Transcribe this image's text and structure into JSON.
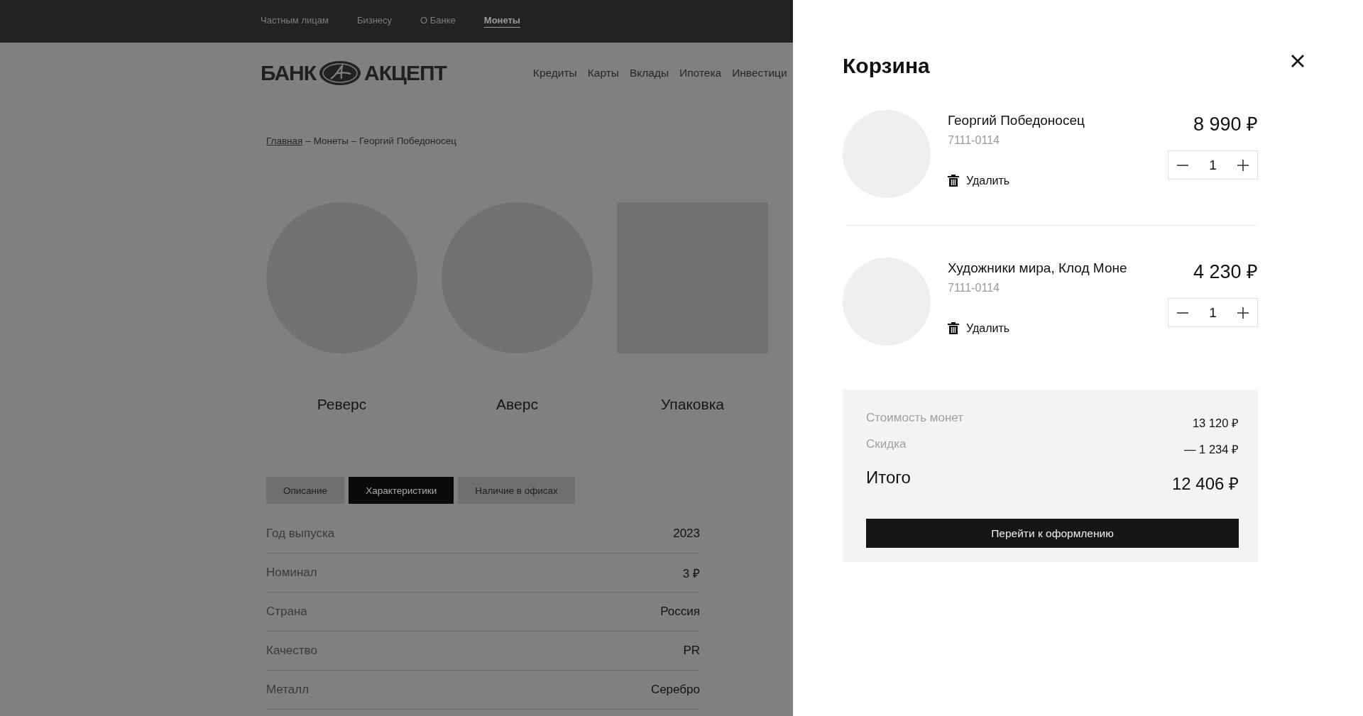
{
  "top_nav": [
    {
      "label": "Частным лицам",
      "selected": false
    },
    {
      "label": "Бизнесу",
      "selected": false
    },
    {
      "label": "О Банке",
      "selected": false
    },
    {
      "label": "Монеты",
      "selected": true
    }
  ],
  "logo": {
    "left": "БАНК",
    "right": "АКЦЕПТ"
  },
  "main_nav": [
    "Кредиты",
    "Карты",
    "Вклады",
    "Ипотека",
    "Инвестици"
  ],
  "breadcrumb": {
    "link": "Главная",
    "rest": "– Монеты – Георгий Победоносец"
  },
  "gallery": [
    {
      "label": "Реверс",
      "kind": "circle"
    },
    {
      "label": "Аверс",
      "kind": "circle"
    },
    {
      "label": "Упаковка",
      "kind": "square"
    }
  ],
  "tabs": [
    {
      "label": "Описание",
      "selected": false
    },
    {
      "label": "Характеристики",
      "selected": true
    },
    {
      "label": "Наличие в офисах",
      "selected": false
    }
  ],
  "specs": [
    {
      "name": "Год выпуска",
      "value": "2023"
    },
    {
      "name": "Номинал",
      "value": "3 ₽"
    },
    {
      "name": "Страна",
      "value": "Россия"
    },
    {
      "name": "Качество",
      "value": "PR"
    },
    {
      "name": "Металл",
      "value": "Серебро"
    }
  ],
  "cart": {
    "title": "Корзина",
    "items": [
      {
        "name": "Георгий Победоносец",
        "code": "7111-0114",
        "price": "8 990 ₽",
        "delete": "Удалить",
        "quantity": "1"
      },
      {
        "name": "Художники мира, Клод Моне",
        "code": "7111-0114",
        "price": "4 230 ₽",
        "delete": "Удалить",
        "quantity": "1"
      }
    ],
    "summary": [
      {
        "label": "Стоимость монет",
        "value": "13 120 ₽"
      },
      {
        "label": "Скидка",
        "value": "— 1 234 ₽"
      }
    ],
    "total": {
      "label": "Итого",
      "value": "12 406 ₽"
    },
    "checkout": "Перейти к оформлению"
  }
}
